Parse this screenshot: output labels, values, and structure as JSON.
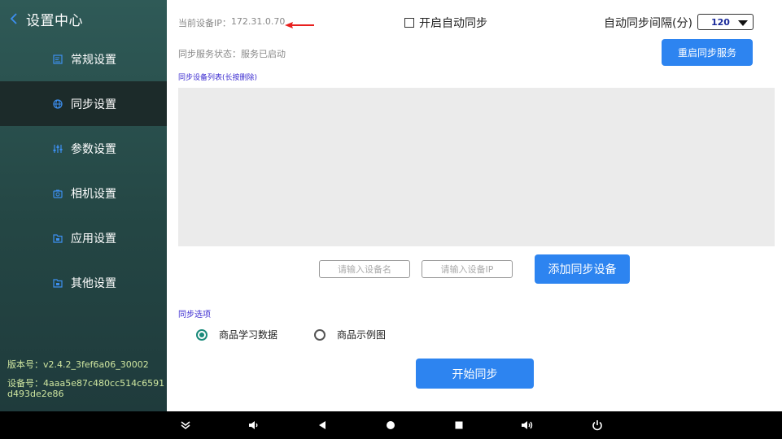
{
  "sidebar": {
    "title": "设置中心",
    "items": [
      {
        "label": "常规设置",
        "icon": "document-edit-icon",
        "active": false
      },
      {
        "label": "同步设置",
        "icon": "globe-icon",
        "active": true
      },
      {
        "label": "参数设置",
        "icon": "sliders-icon",
        "active": false
      },
      {
        "label": "相机设置",
        "icon": "camera-icon",
        "active": false
      },
      {
        "label": "应用设置",
        "icon": "app-folder-icon",
        "active": false
      },
      {
        "label": "其他设置",
        "icon": "other-folder-icon",
        "active": false
      }
    ],
    "version_label": "版本号：",
    "version_value": "v2.4.2_3fef6a06_30002",
    "device_label": "设备号：",
    "device_value": "4aaa5e87c480cc514c6591d493de2e86"
  },
  "main": {
    "ip_label": "当前设备IP：",
    "ip_value": "172.31.0.70",
    "auto_sync_label": "开启自动同步",
    "auto_sync_checked": false,
    "interval_label": "自动同步间隔(分)",
    "interval_value": "120",
    "status_label": "同步服务状态：",
    "status_value": "服务已启动",
    "restart_label": "重启同步服务",
    "list_label": "同步设备列表(长按删除)",
    "name_placeholder": "请输入设备名",
    "ip_placeholder": "请输入设备IP",
    "add_label": "添加同步设备",
    "options_label": "同步选项",
    "option_1": "商品学习数据",
    "option_2": "商品示例图",
    "selected_option": "商品学习数据",
    "start_label": "开始同步"
  },
  "colors": {
    "sidebar_bg": "#2f5a57",
    "sidebar_active": "#1c2b2a",
    "accent_blue": "#2d84f0",
    "icon_blue": "#3d8ff0",
    "version_text": "#cfe6a0",
    "label_purple": "#3b2bd0",
    "radio_green": "#1a8a7a",
    "arrow_red": "#e8201e"
  },
  "navbar": {
    "buttons": [
      "collapse-icon",
      "volume-down-icon",
      "back-icon",
      "home-icon",
      "recents-icon",
      "volume-up-icon",
      "power-icon"
    ]
  }
}
